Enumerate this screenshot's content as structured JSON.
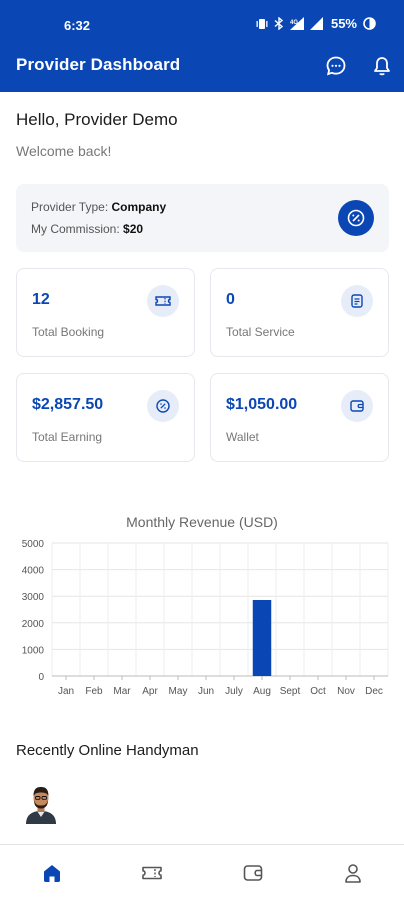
{
  "status_bar": {
    "time": "6:32",
    "battery": "55%"
  },
  "app_bar": {
    "title": "Provider Dashboard",
    "actions": [
      {
        "icon": "chat-icon"
      },
      {
        "icon": "bell-icon"
      }
    ]
  },
  "header": {
    "greeting": "Hello, Provider Demo",
    "welcome": "Welcome back!"
  },
  "provider_info": {
    "type_label": "Provider Type: ",
    "type_value": "Company",
    "commission_label": "My Commission: ",
    "commission_value": "$20",
    "icon": "percent-badge-icon"
  },
  "stats": [
    {
      "value": "12",
      "label": "Total Booking",
      "icon": "ticket-icon"
    },
    {
      "value": "0",
      "label": "Total Service",
      "icon": "document-icon"
    },
    {
      "value": "$2,857.50",
      "label": "Total Earning",
      "icon": "badge-icon"
    },
    {
      "value": "$1,050.00",
      "label": "Wallet",
      "icon": "wallet-icon"
    }
  ],
  "chart_data": {
    "type": "bar",
    "title": "Monthly Revenue (USD)",
    "categories": [
      "Jan",
      "Feb",
      "Mar",
      "Apr",
      "May",
      "Jun",
      "July",
      "Aug",
      "Sept",
      "Oct",
      "Nov",
      "Dec"
    ],
    "values": [
      0,
      0,
      0,
      0,
      0,
      0,
      0,
      2857.5,
      0,
      0,
      0,
      0
    ],
    "y_ticks": [
      0,
      1000,
      2000,
      3000,
      4000,
      5000
    ],
    "ylim": [
      0,
      5000
    ],
    "grid": true,
    "bar_color": "#0b47b4"
  },
  "online_handyman": {
    "title": "Recently Online Handyman"
  },
  "bottom_nav": [
    {
      "icon": "home-icon",
      "active": true
    },
    {
      "icon": "ticket-icon",
      "active": false
    },
    {
      "icon": "wallet-icon",
      "active": false
    },
    {
      "icon": "profile-icon",
      "active": false
    }
  ],
  "colors": {
    "primary": "#0b47b4",
    "muted": "#777777",
    "card_bg": "#f4f5f8"
  }
}
